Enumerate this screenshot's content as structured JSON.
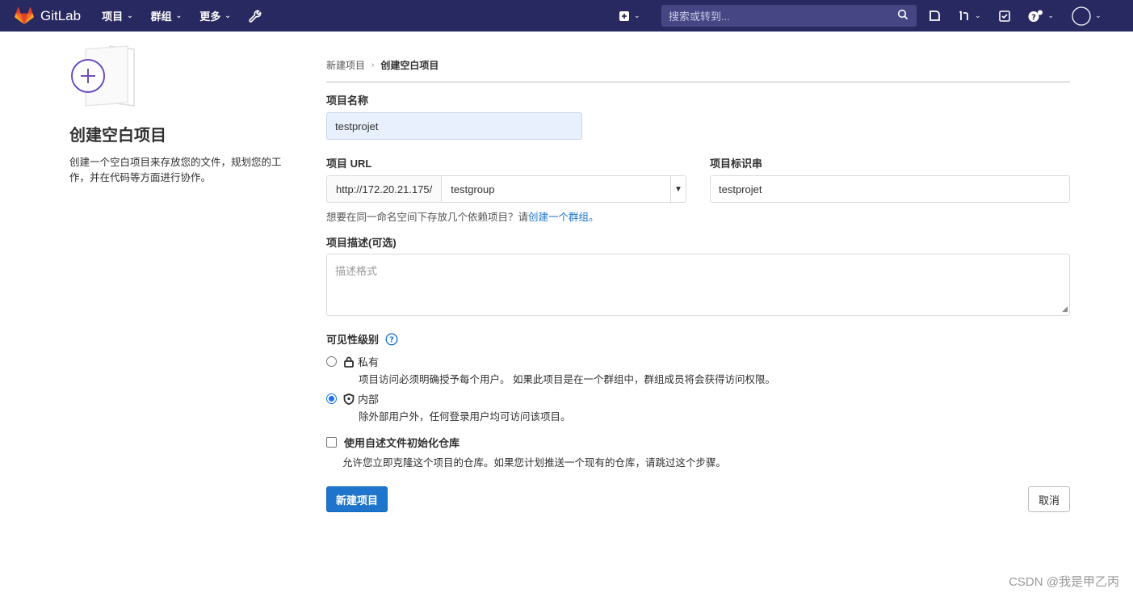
{
  "topbar": {
    "brand": "GitLab",
    "menu": [
      {
        "label": "项目"
      },
      {
        "label": "群组"
      },
      {
        "label": "更多"
      }
    ],
    "search_placeholder": "搜索或转到..."
  },
  "sidebar": {
    "title": "创建空白项目",
    "description": "创建一个空白项目来存放您的文件，规划您的工作，并在代码等方面进行协作。"
  },
  "breadcrumb": {
    "parent": "新建项目",
    "current": "创建空白项目"
  },
  "form": {
    "project_name_label": "项目名称",
    "project_name_value": "testprojet",
    "project_url_label": "项目 URL",
    "url_prefix": "http://172.20.21.175/",
    "namespace": "testgroup",
    "slug_label": "项目标识串",
    "slug_value": "testprojet",
    "help_text": "想要在同一命名空间下存放几个依赖项目？请",
    "help_link": "创建一个群组。",
    "description_label": "项目描述(可选)",
    "description_placeholder": "描述格式",
    "visibility_label": "可见性级别",
    "visibility_options": [
      {
        "label": "私有",
        "description": "项目访问必须明确授予每个用户。 如果此项目是在一个群组中，群组成员将会获得访问权限。",
        "checked": false
      },
      {
        "label": "内部",
        "description": "除外部用户外，任何登录用户均可访问该项目。",
        "checked": true
      }
    ],
    "readme_label": "使用自述文件初始化仓库",
    "readme_description": "允许您立即克隆这个项目的仓库。如果您计划推送一个现有的仓库，请跳过这个步骤。",
    "readme_checked": false,
    "submit_label": "新建项目",
    "cancel_label": "取消"
  },
  "watermark": "CSDN @我是甲乙丙",
  "colors": {
    "topbar": "#292961",
    "primary": "#1f75cb",
    "link": "#1f75cb"
  }
}
